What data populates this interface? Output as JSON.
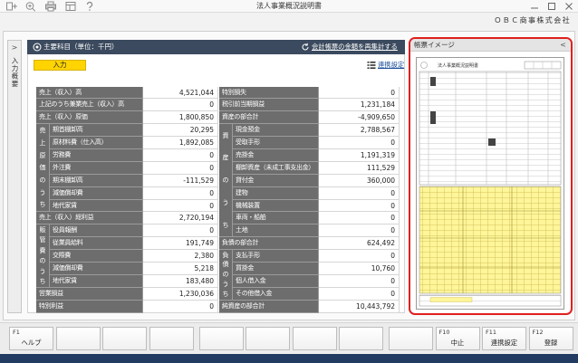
{
  "window": {
    "title": "法人事業概況説明書",
    "company": "ＯＢＣ商事株式会社",
    "controls": [
      "minimize-icon",
      "maximize-icon",
      "close-icon"
    ]
  },
  "toolbar": {
    "icons": [
      "add-icon",
      "zoom-icon",
      "print-icon",
      "layout-icon",
      "help-icon"
    ]
  },
  "side_tab": {
    "chevron": ">",
    "label": "入力概要"
  },
  "panel": {
    "title": "主要科目（単位：千円）",
    "recalc_link": "会計帳票の金額を再集計する",
    "status_badge": "入力",
    "settings_link": "連携設定"
  },
  "table": {
    "left_rows": [
      {
        "label": "売上（収入）高",
        "value": "4,521,044"
      },
      {
        "label": "上記のうち兼業売上（収入）高",
        "value": "0"
      },
      {
        "label": "売上（収入）原価",
        "value": "1,800,850"
      },
      {
        "group": "売上原価のうち",
        "rows": [
          {
            "label": "期首棚卸高",
            "value": "20,295"
          },
          {
            "label": "原材料費（仕入高）",
            "value": "1,892,085"
          },
          {
            "label": "労務費",
            "value": "0"
          },
          {
            "label": "外注費",
            "value": "0"
          },
          {
            "label": "期末棚卸高",
            "value": "-111,529"
          },
          {
            "label": "減価償却費",
            "value": "0"
          },
          {
            "label": "地代家賃",
            "value": "0"
          }
        ]
      },
      {
        "label": "売上（収入）総利益",
        "value": "2,720,194"
      },
      {
        "group": "販管費のうち",
        "rows": [
          {
            "label": "役員報酬",
            "value": "0"
          },
          {
            "label": "従業員給料",
            "value": "191,749"
          },
          {
            "label": "交際費",
            "value": "2,380"
          },
          {
            "label": "減価償却費",
            "value": "5,218"
          },
          {
            "label": "地代家賃",
            "value": "183,480"
          }
        ]
      },
      {
        "label": "営業損益",
        "value": "1,230,036"
      },
      {
        "label": "特別利益",
        "value": "0"
      }
    ],
    "right_rows": [
      {
        "label": "特別損失",
        "value": "0"
      },
      {
        "label": "税引前当期損益",
        "value": "1,231,184"
      },
      {
        "label": "資産の部合計",
        "value": "-4,909,650"
      },
      {
        "group": "資産のうち",
        "rows": [
          {
            "label": "現金預金",
            "value": "2,788,567"
          },
          {
            "label": "受取手形",
            "value": "0"
          },
          {
            "label": "売掛金",
            "value": "1,191,319"
          },
          {
            "label": "棚卸資産（未成工事支出金）",
            "value": "111,529"
          },
          {
            "label": "貸付金",
            "value": "360,000"
          },
          {
            "label": "建物",
            "value": "0"
          },
          {
            "label": "機械装置",
            "value": "0"
          },
          {
            "label": "車両・船舶",
            "value": "0"
          },
          {
            "label": "土地",
            "value": "0"
          }
        ]
      },
      {
        "label": "負債の部合計",
        "value": "624,492"
      },
      {
        "group": "負債のうち",
        "rows": [
          {
            "label": "支払手形",
            "value": "0"
          },
          {
            "label": "買掛金",
            "value": "10,760"
          },
          {
            "label": "個人借入金",
            "value": "0"
          },
          {
            "label": "その他借入金",
            "value": "0"
          }
        ]
      },
      {
        "label": "純資産の部合計",
        "value": "10,443,792"
      }
    ]
  },
  "preview": {
    "title": "帳票イメージ",
    "collapse": "<",
    "form_title": "法人事業概況説明書"
  },
  "function_keys": [
    {
      "key": "F1",
      "label": "ヘルプ"
    },
    {
      "key": "",
      "label": ""
    },
    {
      "key": "",
      "label": ""
    },
    {
      "key": "",
      "label": ""
    },
    {
      "key": "",
      "label": ""
    },
    {
      "key": "",
      "label": ""
    },
    {
      "key": "",
      "label": ""
    },
    {
      "key": "",
      "label": ""
    },
    {
      "key": "",
      "label": ""
    },
    {
      "key": "F10",
      "label": "中止"
    },
    {
      "key": "F11",
      "label": "連携設定"
    },
    {
      "key": "F12",
      "label": "登録"
    }
  ],
  "colors": {
    "header_bg": "#3b4a5e",
    "label_bg": "#6d6d6d",
    "badge": "#ffd400",
    "highlight_border": "#e02020",
    "status_bar": "#213b63"
  }
}
